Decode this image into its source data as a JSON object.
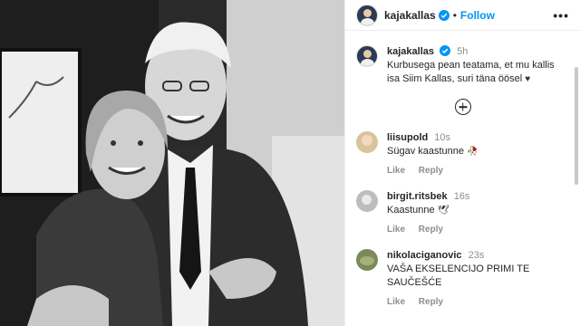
{
  "header": {
    "username": "kajakallas",
    "follow_label": "Follow",
    "more_label": "•••"
  },
  "caption": {
    "username": "kajakallas",
    "time": "5h",
    "text": "Kurbusega pean teatama, et mu kallis isa Siim Kallas, suri täna öösel",
    "emoji": "♥"
  },
  "load_more_icon": "plus-circle-icon",
  "comments": [
    {
      "username": "liisupold",
      "time": "10s",
      "text": "Sügav kaastunne",
      "emoji": "🥀",
      "like_label": "Like",
      "reply_label": "Reply"
    },
    {
      "username": "birgit.ritsbek",
      "time": "16s",
      "text": "Kaastunne",
      "emoji": "🕊",
      "like_label": "Like",
      "reply_label": "Reply"
    },
    {
      "username": "nikolaciganovic",
      "time": "23s",
      "text": "VAŠA EKSELENCIJO PRIMI TE SAUČEŠĆE",
      "emoji": "",
      "like_label": "Like",
      "reply_label": "Reply"
    }
  ],
  "colors": {
    "accent": "#0095f6",
    "verified": "#0095f6",
    "muted": "#8e8e8e"
  }
}
